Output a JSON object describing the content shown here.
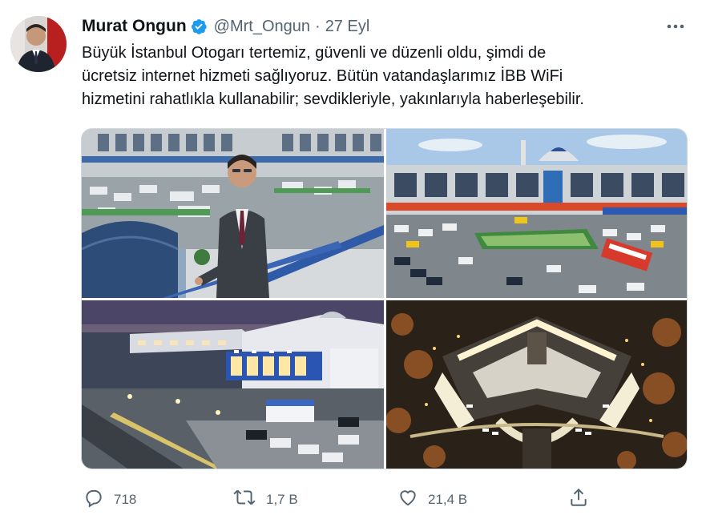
{
  "tweet": {
    "author_name": "Murat Ongun",
    "handle": "@Mrt_Ongun",
    "separator": "·",
    "time": "27 Eyl",
    "text_lines": [
      "Büyük İstanbul Otogarı tertemiz, güvenli ve düzenli oldu, şimdi de",
      "ücretsiz internet hizmeti sağlıyoruz. Bütün vatandaşlarımız İBB WiFi",
      "hizmetini rahatlıkla kullanabilir; sevdikleriyle, yakınlarıyla haberleşebilir."
    ]
  },
  "actions": {
    "replies": "718",
    "retweets": "1,7 B",
    "likes": "21,4 B"
  },
  "icons": {
    "verified": "verified-badge-icon",
    "more": "more-options-icon",
    "reply": "reply-icon",
    "retweet": "retweet-icon",
    "like": "heart-icon",
    "share": "share-icon"
  },
  "colors": {
    "verified_blue": "#1d9bf0",
    "text_primary": "#0f1419",
    "text_secondary": "#536471"
  }
}
